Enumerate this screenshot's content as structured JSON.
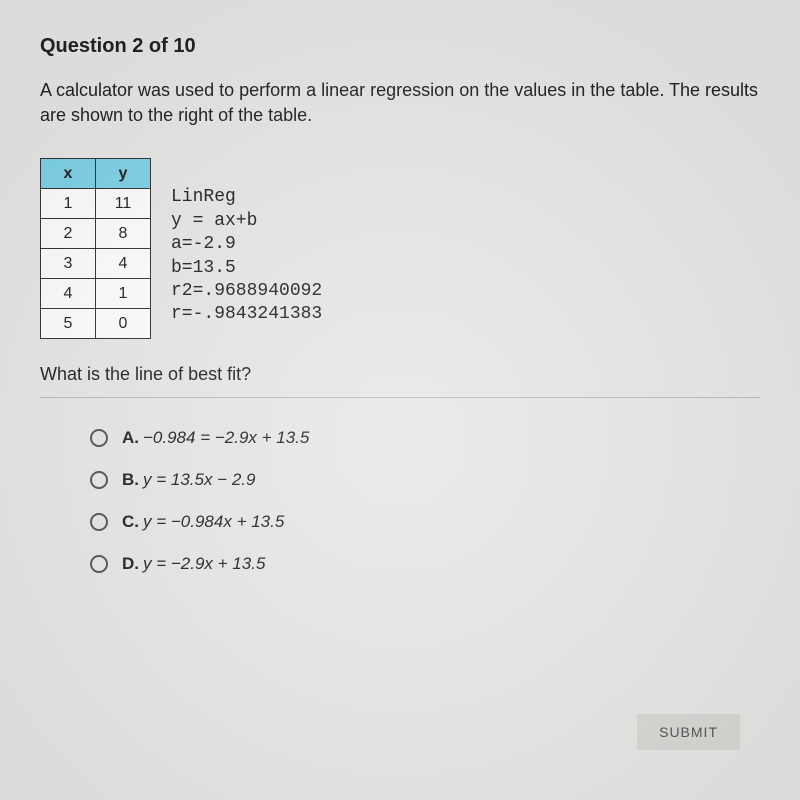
{
  "header": "Question 2 of 10",
  "prompt": "A calculator was used to perform a linear regression on the values in the table. The results are shown to the right of the table.",
  "table": {
    "headers": [
      "x",
      "y"
    ],
    "rows": [
      [
        "1",
        "11"
      ],
      [
        "2",
        "8"
      ],
      [
        "3",
        "4"
      ],
      [
        "4",
        "1"
      ],
      [
        "5",
        "0"
      ]
    ]
  },
  "linreg": {
    "title": "LinReg",
    "lines": [
      "y = ax+b",
      "a=-2.9",
      "b=13.5",
      "r2=.9688940092",
      "r=-.9843241383"
    ]
  },
  "subquestion": "What is the line of best fit?",
  "options": [
    {
      "letter": "A.",
      "text": "−0.984 = −2.9x + 13.5"
    },
    {
      "letter": "B.",
      "text": "y = 13.5x − 2.9"
    },
    {
      "letter": "C.",
      "text": "y = −0.984x + 13.5"
    },
    {
      "letter": "D.",
      "text": "y = −2.9x + 13.5"
    }
  ],
  "submit_label": "SUBMIT",
  "chart_data": {
    "type": "table",
    "title": "Linear regression data and results",
    "columns": [
      "x",
      "y"
    ],
    "rows": [
      [
        1,
        11
      ],
      [
        2,
        8
      ],
      [
        3,
        4
      ],
      [
        4,
        1
      ],
      [
        5,
        0
      ]
    ],
    "regression": {
      "model": "y = ax + b",
      "a": -2.9,
      "b": 13.5,
      "r2": 0.9688940092,
      "r": -0.9843241383
    }
  }
}
